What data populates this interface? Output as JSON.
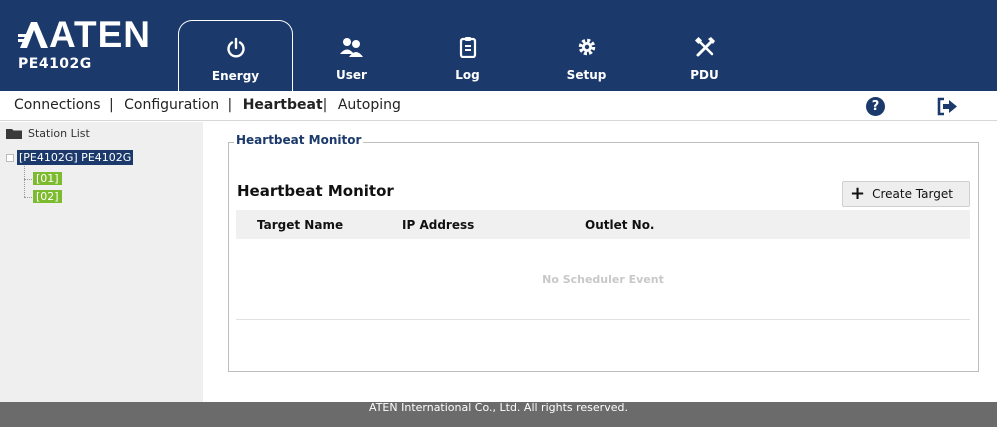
{
  "brand": {
    "logo_text": "ATEN",
    "model": "PE4102G"
  },
  "tabs": [
    {
      "label": "Energy",
      "icon": "power-icon",
      "active": true
    },
    {
      "label": "User",
      "icon": "users-icon",
      "active": false
    },
    {
      "label": "Log",
      "icon": "clipboard-icon",
      "active": false
    },
    {
      "label": "Setup",
      "icon": "gear-icon",
      "active": false
    },
    {
      "label": "PDU",
      "icon": "tools-icon",
      "active": false
    }
  ],
  "subnav": {
    "items": [
      "Connections",
      "Configuration",
      "Heartbeat",
      "Autoping"
    ],
    "active": "Heartbeat",
    "separator": "|"
  },
  "sidebar": {
    "title": "Station List",
    "device": "[PE4102G] PE4102G",
    "outlets": [
      "[01]",
      "[02]"
    ]
  },
  "main": {
    "fieldset_legend": "Heartbeat Monitor",
    "section_title": "Heartbeat Monitor",
    "create_button": "Create Target",
    "columns": [
      "Target Name",
      "IP Address",
      "Outlet No."
    ],
    "empty_message": "No Scheduler Event"
  },
  "footer": {
    "text": "ATEN International Co., Ltd. All rights reserved."
  },
  "colors": {
    "header_bg": "#1b3a6b",
    "outlet_green": "#7cbb2e",
    "footer_bg": "#6b6b6b"
  }
}
